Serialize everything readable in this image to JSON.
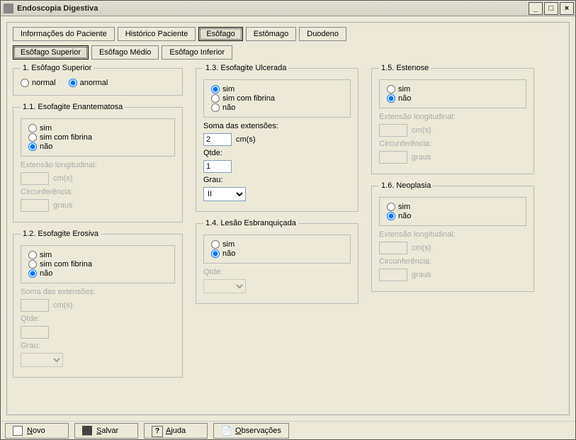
{
  "window": {
    "title": "Endoscopia Digestiva"
  },
  "tabs": {
    "main": [
      {
        "label": "Informações do Paciente",
        "active": false
      },
      {
        "label": "Histórico Paciente",
        "active": false
      },
      {
        "label": "Esôfago",
        "active": true
      },
      {
        "label": "Estômago",
        "active": false
      },
      {
        "label": "Duodeno",
        "active": false
      }
    ],
    "sub": [
      {
        "label": "Esôfago Superior",
        "active": true
      },
      {
        "label": "Esôfago Médio",
        "active": false
      },
      {
        "label": "Esôfago Inferior",
        "active": false
      }
    ]
  },
  "groups": {
    "g1": {
      "title": "1. Esôfago Superior",
      "opts": {
        "a": "normal",
        "b": "anormal"
      },
      "sel": "b"
    },
    "g11": {
      "title": "1.1. Esofagite Enantematosa",
      "opts": [
        "sim",
        "sim com fibrina",
        "não"
      ],
      "sel": 2,
      "ext_label": "Extensão longitudinal:",
      "ext_val": "",
      "ext_unit": "cm(s)",
      "circ_label": "Circunferência:",
      "circ_val": "",
      "circ_unit": "graus"
    },
    "g12": {
      "title": "1.2. Esofagite Erosiva",
      "opts": [
        "sim",
        "sim com fibrina",
        "não"
      ],
      "sel": 2,
      "soma_label": "Soma das extensões:",
      "soma_val": "",
      "soma_unit": "cm(s)",
      "qtde_label": "Qtde:",
      "qtde_val": "",
      "grau_label": "Grau:",
      "grau_val": ""
    },
    "g13": {
      "title": "1.3. Esofagite Ulcerada",
      "opts": [
        "sim",
        "sim com fibrina",
        "não"
      ],
      "sel": 0,
      "soma_label": "Soma das extensões:",
      "soma_val": "2",
      "soma_unit": "cm(s)",
      "qtde_label": "Qtde:",
      "qtde_val": "1",
      "grau_label": "Grau:",
      "grau_val": "II"
    },
    "g14": {
      "title": "1.4. Lesão Esbranquiçada",
      "opts": [
        "sim",
        "não"
      ],
      "sel": 1,
      "qtde_label": "Qtde:",
      "qtde_val": ""
    },
    "g15": {
      "title": "1.5. Estenose",
      "opts": [
        "sim",
        "não"
      ],
      "sel": 1,
      "ext_label": "Extensão longitudinal:",
      "ext_val": "",
      "ext_unit": "cm(s)",
      "circ_label": "Circunferência:",
      "circ_val": "",
      "circ_unit": "graus"
    },
    "g16": {
      "title": "1.6. Neoplasia",
      "opts": [
        "sim",
        "não"
      ],
      "sel": 1,
      "ext_label": "Extensão longitudinal:",
      "ext_val": "",
      "ext_unit": "cm(s)",
      "circ_label": "Circunferência:",
      "circ_val": "",
      "circ_unit": "graus"
    }
  },
  "buttons": {
    "novo": "Novo",
    "salvar": "Salvar",
    "ajuda": "Ajuda",
    "obs": "Observações"
  }
}
